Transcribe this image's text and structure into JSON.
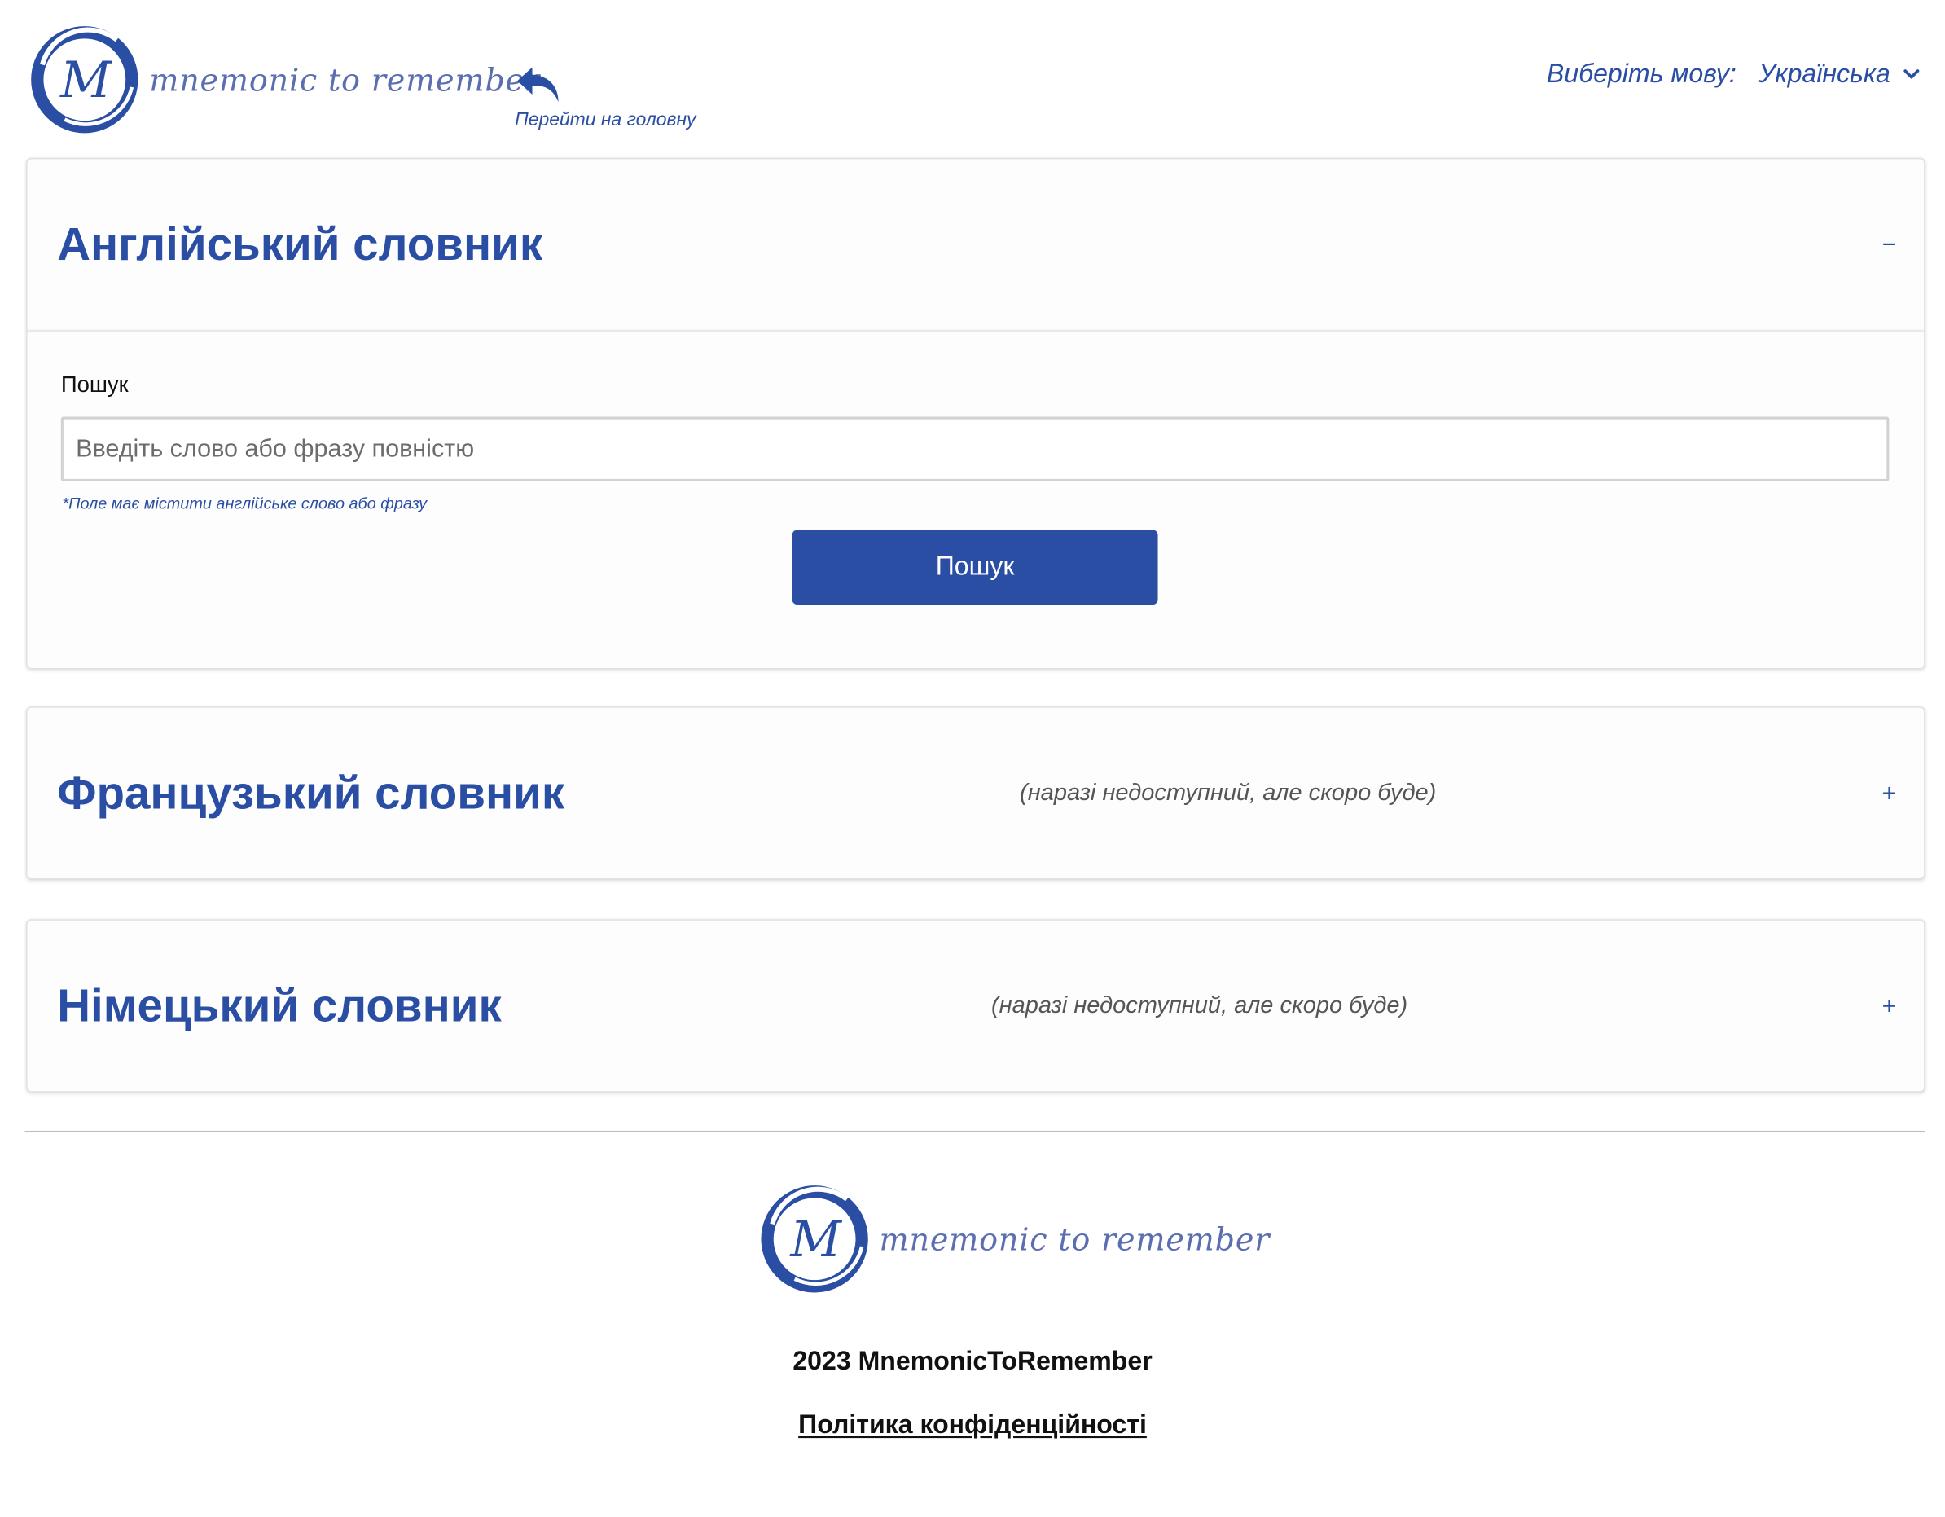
{
  "brand": {
    "logo_letter": "M",
    "logo_text": "mnemonic to remember",
    "primary_color": "#2a4ea3"
  },
  "header": {
    "home_link_label": "Перейти на головну",
    "home_icon": "back-arrow-icon",
    "language_label": "Виберіть мову:",
    "language_value": "Українська",
    "language_icon": "chevron-down-icon"
  },
  "dictionaries": [
    {
      "title": "Англійський словник",
      "note": "",
      "toggle": "−",
      "expanded": true,
      "search": {
        "label": "Пошук",
        "placeholder": "Введіть слово або фразу повністю",
        "value": "",
        "hint": "*Поле має містити англійське слово або фразу",
        "button_label": "Пошук"
      }
    },
    {
      "title": "Французький словник",
      "note": "(наразі недоступний, але скоро буде)",
      "toggle": "+",
      "expanded": false
    },
    {
      "title": "Німецький словник",
      "note": "(наразі недоступний, але скоро буде)",
      "toggle": "+",
      "expanded": false
    }
  ],
  "footer": {
    "copyright": "2023 MnemonicToRemember",
    "policy_link": "Політика конфіденційності"
  }
}
